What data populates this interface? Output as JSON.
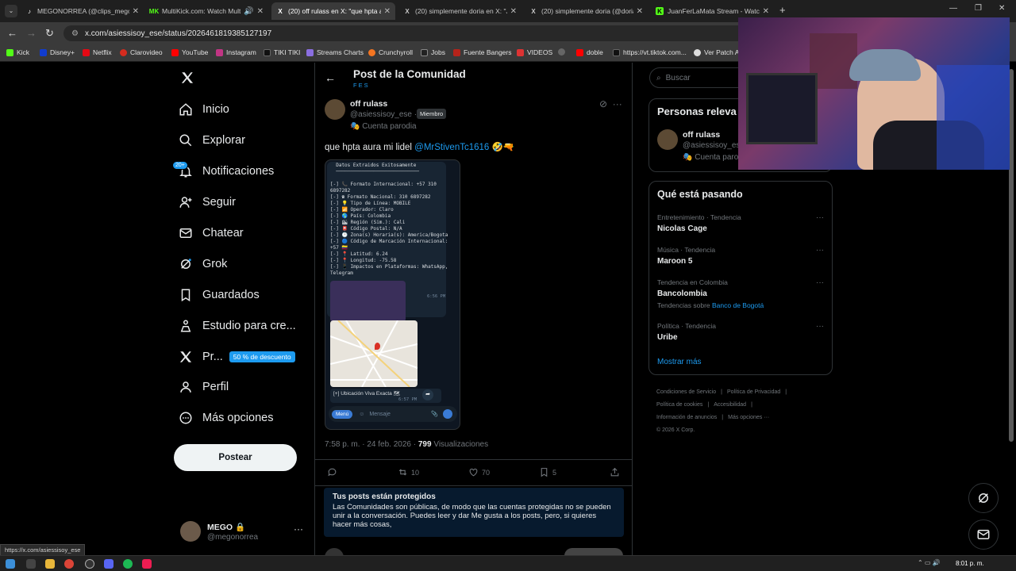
{
  "browser": {
    "tabs": [
      {
        "title": "MEGONORREA (@clips_megon",
        "icon": "tiktok"
      },
      {
        "title": "MultiKick.com: Watch Multi",
        "icon": "multikick"
      },
      {
        "title": "(20) off rulass en X: \"que hpta a",
        "icon": "x",
        "active": true
      },
      {
        "title": "(20) simplemente doria en X: \"J",
        "icon": "x"
      },
      {
        "title": "(20) simplemente doria (@doria",
        "icon": "x"
      },
      {
        "title": "JuanFerLaMata Stream - Watch",
        "icon": "kick"
      }
    ],
    "url": "x.com/asiessisoy_ese/status/2026461819385127197",
    "bookmarks": [
      "Kick",
      "Disney+",
      "Netflix",
      "Clarovideo",
      "YouTube",
      "Instagram",
      "TIKI TIKI",
      "Streams Charts",
      "Crunchyroll",
      "Jobs",
      "Fuente Bangers",
      "VIDEOS",
      "",
      "doble",
      "https://vt.tiktok.com...",
      "Ver Patch A"
    ],
    "status_url": "https://x.com/asiessisoy_ese"
  },
  "nav": {
    "items": [
      "Inicio",
      "Explorar",
      "Notificaciones",
      "Seguir",
      "Chatear",
      "Grok",
      "Guardados",
      "Estudio para cre...",
      "Pr...",
      "Perfil",
      "Más opciones"
    ],
    "notif_badge": "20+",
    "discount_badge": "50 % de descuento",
    "post_button": "Postear",
    "account_name": "MEGO",
    "account_handle": "@megonorrea"
  },
  "header": {
    "title": "Post de la Comunidad",
    "subtitle": "FES"
  },
  "post": {
    "name": "off rulass",
    "handle": "@asiessisoy_ese ·",
    "member": "Miembro",
    "parody": "Cuenta parodia",
    "text": "que hpta aura mi lidel",
    "mention": "@MrStivenTc1616",
    "emoji": "🤣🔫",
    "time": "7:58 p. m. · 24 feb. 2026 · ",
    "views_count": "799",
    "views_label": " Visualizaciones",
    "retweets": "10",
    "likes": "70",
    "bookmarks": "5"
  },
  "telegram": {
    "lines": [
      "  Datos Extraidos Exitosamente",
      "  ─────────────────────────────",
      "",
      "[-] 📞 Formato Internacional: +57 310",
      "6897282",
      "[-] ☎ Formato Nacional: 310 6897282",
      "[-] 💡 Tipo de Línea: MOBILE",
      "[-] 📶 Operador: Claro",
      "[-] 🌎 País: Colombia",
      "[-] 🏙 Región (Sim.): Cali",
      "[-] 📮 Código Postal: N/A",
      "[-] 🕐 Zona(s) Horaria(s): America/Bogota",
      "[-] 🔵 Código de Marcación Internacional:",
      "+57 🇨🇴",
      "[-] 📍 Latitud: 6.24",
      "[-] 📍 Longitud: -75.58",
      "[-] 📱 Impactos en Plataformas: WhatsApp,",
      "Telegram"
    ],
    "time1": "6:56 PM",
    "location": "[+] Ubicación Viva Exacta 🗺",
    "time2": "6:57 PM",
    "menu": "Menú",
    "message_placeholder": "Mensaje"
  },
  "protected": {
    "title": "Tus posts están protegidos",
    "body": "Las Comunidades son públicas, de modo que las cuentas protegidas no se pueden unir a la conversación. Puedes leer y dar Me gusta a los posts, pero, si quieres hacer más cosas,"
  },
  "right": {
    "search_placeholder": "Buscar",
    "people_title": "Personas releva",
    "person_name": "off rulass",
    "person_handle": "@asiessisoy_ese",
    "person_parody": "Cuenta parodia",
    "trends_title": "Qué está pasando",
    "trends": [
      {
        "category": "Entretenimiento · Tendencia",
        "name": "Nicolas Cage",
        "sub": "",
        "sublink": ""
      },
      {
        "category": "Música · Tendencia",
        "name": "Maroon 5",
        "sub": "",
        "sublink": ""
      },
      {
        "category": "Tendencia en Colombia",
        "name": "Bancolombia",
        "sub": "Tendencias sobre ",
        "sublink": "Banco de Bogotá"
      },
      {
        "category": "Política · Tendencia",
        "name": "Uribe",
        "sub": "",
        "sublink": ""
      }
    ],
    "show_more": "Mostrar más",
    "footer": [
      "Condiciones de Servicio",
      "|",
      "Política de Privacidad",
      "|",
      "Política de cookies",
      "|",
      "Accesibilidad",
      "|",
      "Información de anuncios",
      "|",
      "Más opciones ···",
      "© 2026 X Corp."
    ]
  },
  "taskbar": {
    "clock": "8:01 p. m."
  },
  "colors": {
    "accent": "#1d9bf0",
    "bg": "#000000",
    "border": "#2f3336"
  }
}
